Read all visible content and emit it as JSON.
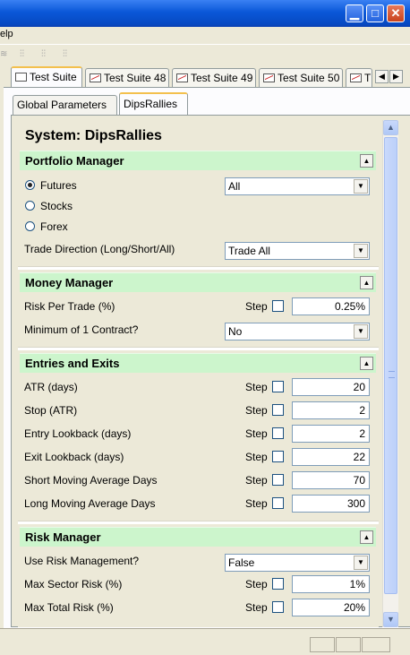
{
  "window": {
    "title": "",
    "controls": {
      "minimize": "minimize",
      "maximize": "maximize",
      "close": "close"
    }
  },
  "menubar": {
    "partial_item": "elp"
  },
  "suite_tabs": [
    {
      "label": "Test Suite",
      "icon": "window-icon",
      "active": true
    },
    {
      "label": "Test Suite 48",
      "icon": "chart-icon"
    },
    {
      "label": "Test Suite 49",
      "icon": "chart-icon"
    },
    {
      "label": "Test Suite 50",
      "icon": "chart-icon"
    },
    {
      "label": "T",
      "icon": "chart-icon"
    }
  ],
  "sub_tabs": [
    {
      "label": "Global Parameters"
    },
    {
      "label": "DipsRallies",
      "active": true
    }
  ],
  "system_title": "System: DipsRallies",
  "portfolio_manager": {
    "title": "Portfolio Manager",
    "market_options": [
      {
        "label": "Futures",
        "selected": true
      },
      {
        "label": "Stocks",
        "selected": false
      },
      {
        "label": "Forex",
        "selected": false
      }
    ],
    "market_filter_value": "All",
    "trade_direction_label": "Trade Direction (Long/Short/All)",
    "trade_direction_value": "Trade All"
  },
  "money_manager": {
    "title": "Money Manager",
    "risk_label": "Risk Per Trade (%)",
    "risk_value": "0.25%",
    "min_contract_label": "Minimum of 1 Contract?",
    "min_contract_value": "No"
  },
  "entries_exits": {
    "title": "Entries and Exits",
    "rows": [
      {
        "label": "ATR (days)",
        "value": "20"
      },
      {
        "label": "Stop (ATR)",
        "value": "2"
      },
      {
        "label": "Entry Lookback (days)",
        "value": "2"
      },
      {
        "label": "Exit Lookback (days)",
        "value": "22"
      },
      {
        "label": "Short Moving Average Days",
        "value": "70"
      },
      {
        "label": "Long Moving Average Days",
        "value": "300"
      }
    ]
  },
  "risk_manager": {
    "title": "Risk Manager",
    "use_label": "Use Risk Management?",
    "use_value": "False",
    "sector_label": "Max Sector Risk (%)",
    "sector_value": "1%",
    "total_label": "Max Total Risk (%)",
    "total_value": "20%"
  },
  "step_label": "Step",
  "colors": {
    "section_header": "#ccf5cc",
    "panel": "#ece9d8",
    "titlebar": "#0a57d8",
    "active_tab_accent": "#f3c04d"
  }
}
